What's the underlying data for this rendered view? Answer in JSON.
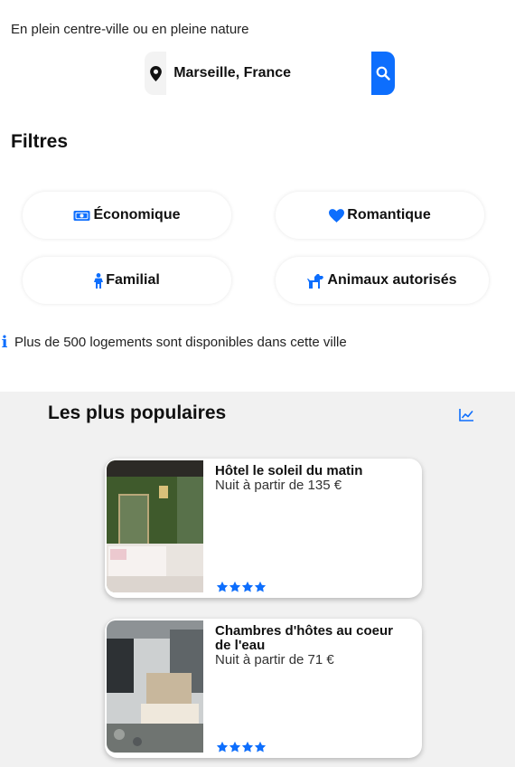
{
  "header": {
    "tagline": "En plein centre-ville ou en pleine nature"
  },
  "search": {
    "value": "Marseille, France",
    "pin_icon": "map-pin-icon",
    "button_icon": "search-icon"
  },
  "filters": {
    "title": "Filtres",
    "items": [
      {
        "label": "Économique",
        "icon": "money-icon"
      },
      {
        "label": "Romantique",
        "icon": "heart-icon"
      },
      {
        "label": "Familial",
        "icon": "person-icon"
      },
      {
        "label": "Animaux autorisés",
        "icon": "dog-icon"
      }
    ]
  },
  "info": {
    "text": "Plus de 500 logements sont disponibles dans cette ville"
  },
  "popular": {
    "title": "Les plus populaires",
    "trend_icon": "chart-line-icon",
    "cards": [
      {
        "name": "Hôtel le soleil du matin",
        "price": "Nuit à partir de 135 €",
        "stars": 4
      },
      {
        "name": "Chambres d'hôtes au coeur de l'eau",
        "price": "Nuit à partir de 71 €",
        "stars": 4
      }
    ]
  },
  "colors": {
    "accent": "#0d6efd",
    "section_bg": "#f1f1f1"
  }
}
